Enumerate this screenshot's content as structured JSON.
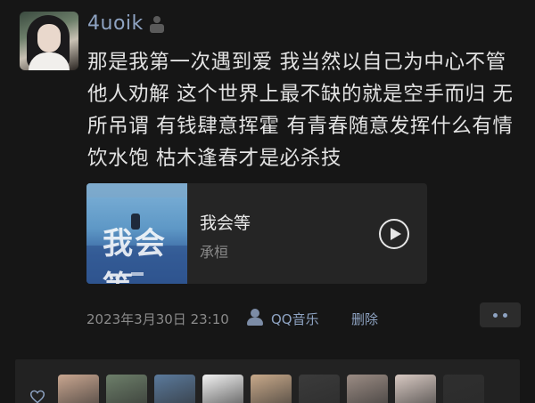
{
  "post": {
    "username": "4uoik",
    "text": "那是我第一次遇到爱 我当然以自己为中心不管他人劝解 这个世界上最不缺的就是空手而归 无所吊谓 有钱肆意挥霍 有青春随意发挥什么有情饮水饱 枯木逢春才是必杀技"
  },
  "music": {
    "title": "我会等",
    "artist": "承桓",
    "cover_text": "我会等"
  },
  "meta": {
    "timestamp": "2023年3月30日 23:10",
    "source": "QQ音乐",
    "delete_label": "删除"
  },
  "likes": {
    "avatars": [
      {
        "name": "liker-avatar-1",
        "color": "#c9a690"
      },
      {
        "name": "liker-avatar-2",
        "color": "#6d7f6a"
      },
      {
        "name": "liker-avatar-3",
        "color": "#5b7a9c"
      },
      {
        "name": "liker-avatar-4",
        "color": "#f2f2f2"
      },
      {
        "name": "liker-avatar-5",
        "color": "#c8a98a"
      },
      {
        "name": "liker-avatar-6",
        "color": "#3b3b3b"
      },
      {
        "name": "liker-avatar-7",
        "color": "#9b8c84"
      },
      {
        "name": "liker-avatar-8",
        "color": "#d8c9c2"
      },
      {
        "name": "liker-avatar-9",
        "color": "#2f2f2f"
      }
    ]
  },
  "colors": {
    "background": "#161616",
    "link": "#8ea3c2",
    "card": "#252525"
  }
}
